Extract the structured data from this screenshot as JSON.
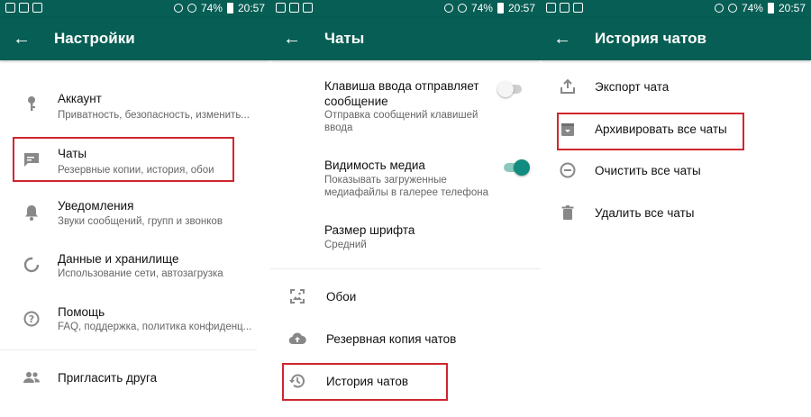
{
  "status": {
    "battery": "74%",
    "time": "20:57"
  },
  "colors": {
    "header": "#075e54",
    "accent": "#128c7e",
    "highlight": "#d0262f"
  },
  "screen1": {
    "title": "Настройки",
    "items": [
      {
        "icon": "key-icon",
        "title": "Аккаунт",
        "subtitle": "Приватность, безопасность, изменить..."
      },
      {
        "icon": "chat-icon",
        "title": "Чаты",
        "subtitle": "Резервные копии, история, обои"
      },
      {
        "icon": "bell-icon",
        "title": "Уведомления",
        "subtitle": "Звуки сообщений, групп и звонков"
      },
      {
        "icon": "data-usage-icon",
        "title": "Данные и хранилище",
        "subtitle": "Использование сети, автозагрузка"
      },
      {
        "icon": "help-icon",
        "title": "Помощь",
        "subtitle": "FAQ, поддержка, политика конфиденц..."
      },
      {
        "icon": "people-icon",
        "title": "Пригласить друга"
      }
    ]
  },
  "screen2": {
    "title": "Чаты",
    "enter_send": {
      "title_line1": "Клавиша ввода отправляет",
      "title_line2": "сообщение",
      "subtitle_line1": "Отправка сообщений клавишей",
      "subtitle_line2": "ввода",
      "enabled": false
    },
    "media_visibility": {
      "title": "Видимость медиа",
      "subtitle_line1": "Показывать загруженные",
      "subtitle_line2": "медиафайлы в галерее телефона",
      "enabled": true
    },
    "font_size": {
      "title": "Размер шрифта",
      "value": "Средний"
    },
    "items": [
      {
        "icon": "wallpaper-icon",
        "title": "Обои"
      },
      {
        "icon": "cloud-upload-icon",
        "title": "Резервная копия чатов"
      },
      {
        "icon": "history-icon",
        "title": "История чатов"
      }
    ]
  },
  "screen3": {
    "title": "История чатов",
    "items": [
      {
        "icon": "export-icon",
        "title": "Экспорт чата"
      },
      {
        "icon": "archive-icon",
        "title": "Архивировать все чаты"
      },
      {
        "icon": "minus-circle-icon",
        "title": "Очистить все чаты"
      },
      {
        "icon": "trash-icon",
        "title": "Удалить все чаты"
      }
    ]
  }
}
